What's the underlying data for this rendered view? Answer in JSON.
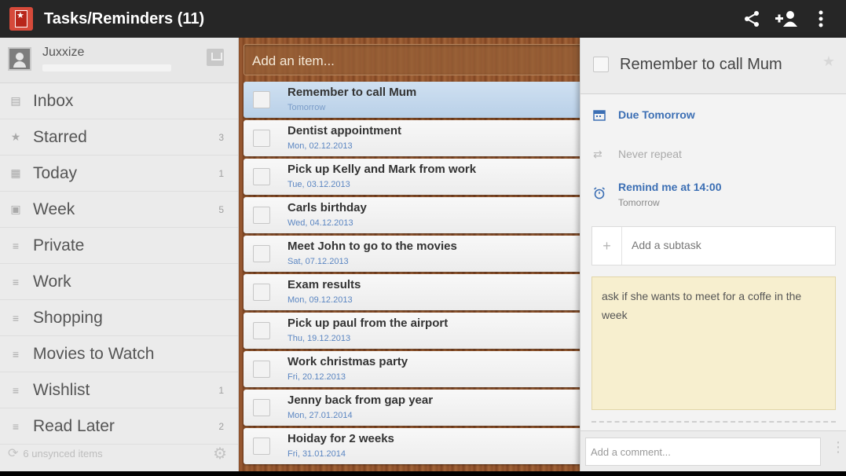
{
  "appbar": {
    "title": "Tasks/Reminders (11)",
    "icons": [
      "wunderlist-app-icon",
      "share-icon",
      "add-person-icon",
      "overflow-menu-icon"
    ]
  },
  "account": {
    "name": "Juxxize"
  },
  "sidebar": {
    "items": [
      {
        "label": "Inbox",
        "count": "",
        "icon": "inbox-icon"
      },
      {
        "label": "Starred",
        "count": "3",
        "icon": "star-icon"
      },
      {
        "label": "Today",
        "count": "1",
        "icon": "calendar-icon"
      },
      {
        "label": "Week",
        "count": "5",
        "icon": "week-calendar-icon"
      },
      {
        "label": "Private",
        "count": "",
        "icon": "list-icon"
      },
      {
        "label": "Work",
        "count": "",
        "icon": "list-icon"
      },
      {
        "label": "Shopping",
        "count": "",
        "icon": "list-icon"
      },
      {
        "label": "Movies to Watch",
        "count": "",
        "icon": "list-icon"
      },
      {
        "label": "Wishlist",
        "count": "1",
        "icon": "list-icon"
      },
      {
        "label": "Read Later",
        "count": "2",
        "icon": "list-icon"
      }
    ],
    "footer_text": "6 unsynced items"
  },
  "tasks": {
    "add_placeholder": "Add an item...",
    "items": [
      {
        "title": "Remember to call Mum",
        "date": "Tomorrow",
        "selected": true
      },
      {
        "title": "Dentist appointment",
        "date": "Mon, 02.12.2013"
      },
      {
        "title": "Pick up Kelly and Mark from work",
        "date": "Tue, 03.12.2013"
      },
      {
        "title": "Carls birthday",
        "date": "Wed, 04.12.2013"
      },
      {
        "title": "Meet John to go to the movies",
        "date": "Sat, 07.12.2013"
      },
      {
        "title": "Exam results",
        "date": "Mon, 09.12.2013"
      },
      {
        "title": "Pick up paul from the airport",
        "date": "Thu, 19.12.2013"
      },
      {
        "title": "Work christmas party",
        "date": "Fri, 20.12.2013"
      },
      {
        "title": "Jenny back from gap year",
        "date": "Mon, 27.01.2014"
      },
      {
        "title": "Hoiday for 2 weeks",
        "date": "Fri, 31.01.2014"
      }
    ]
  },
  "detail": {
    "title": "Remember to call Mum",
    "due": "Due Tomorrow",
    "repeat": "Never repeat",
    "remind": "Remind me at 14:00",
    "remind_sub": "Tomorrow",
    "subtask_placeholder": "Add a subtask",
    "note": "ask if she wants to meet for a coffe in the week",
    "comment_placeholder": "Add a comment..."
  },
  "colors": {
    "accent_blue": "#3c6fb4",
    "app_red": "#d64a3a",
    "note_yellow": "#f7efcf"
  }
}
